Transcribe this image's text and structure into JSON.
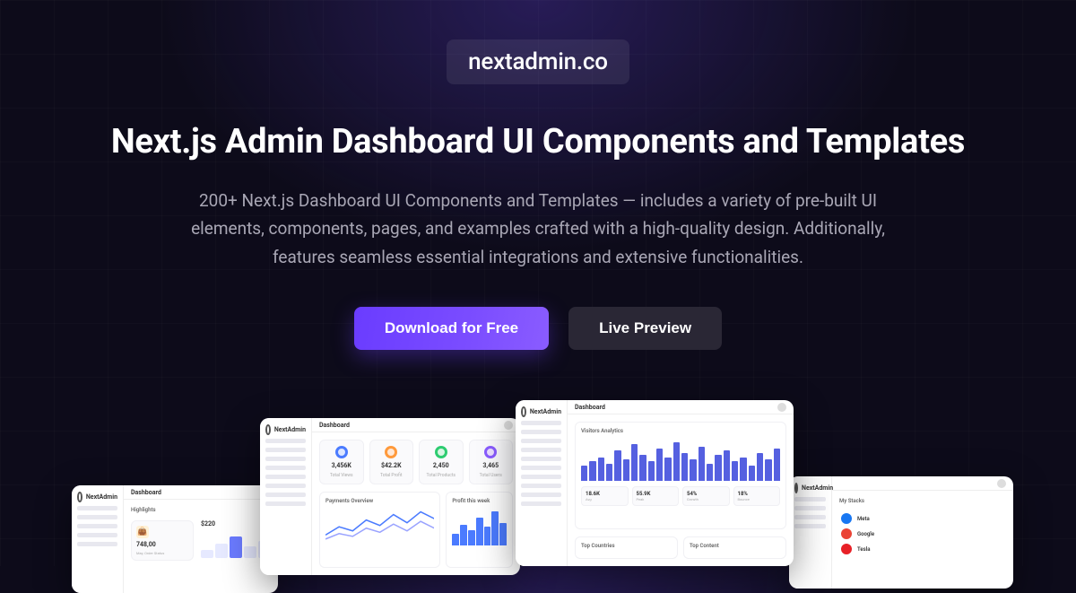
{
  "badge": {
    "text": "nextadmin.co"
  },
  "hero": {
    "title": "Next.js Admin Dashboard UI Components and Templates",
    "subtitle": "200+ Next.js Dashboard UI Components and Templates — includes a variety of pre-built UI elements, components, pages, and examples crafted with a high-quality design. Additionally, features seamless essential integrations and extensive functionalities."
  },
  "cta": {
    "primary": "Download for Free",
    "secondary": "Live Preview"
  },
  "previews": {
    "shot1": {
      "brand": "NextAdmin",
      "title": "Dashboard",
      "section": "Highlights",
      "card": {
        "value": "748,00",
        "sub": "May, Order Status"
      }
    },
    "shot2": {
      "brand": "NextAdmin",
      "title": "Dashboard",
      "stats": [
        {
          "value": "3,456K",
          "label": "Total Views"
        },
        {
          "value": "$42.2K",
          "label": "Total Profit"
        },
        {
          "value": "2,450",
          "label": "Total Products"
        },
        {
          "value": "3,465",
          "label": "Total Users"
        }
      ],
      "panelLeft": "Payments Overview",
      "panelRight": "Profit this week"
    },
    "shot3": {
      "brand": "NextAdmin",
      "title": "Dashboard",
      "panelTitle": "Visitors Analytics",
      "kpis": [
        {
          "value": "18.6K",
          "label": "Avg"
        },
        {
          "value": "55.9K",
          "label": "Peak"
        },
        {
          "value": "54%",
          "label": "Growth"
        },
        {
          "value": "18%",
          "label": "Bounce"
        }
      ],
      "colLeft": "Top Countries",
      "colRight": "Top Content"
    },
    "shot4": {
      "brand": "NextAdmin",
      "panelTitle": "My Stacks",
      "socials": [
        {
          "name": "Meta",
          "color": "#1877f2"
        },
        {
          "name": "Google",
          "color": "#ea4335"
        },
        {
          "name": "Tesla",
          "color": "#e82127"
        }
      ]
    }
  }
}
